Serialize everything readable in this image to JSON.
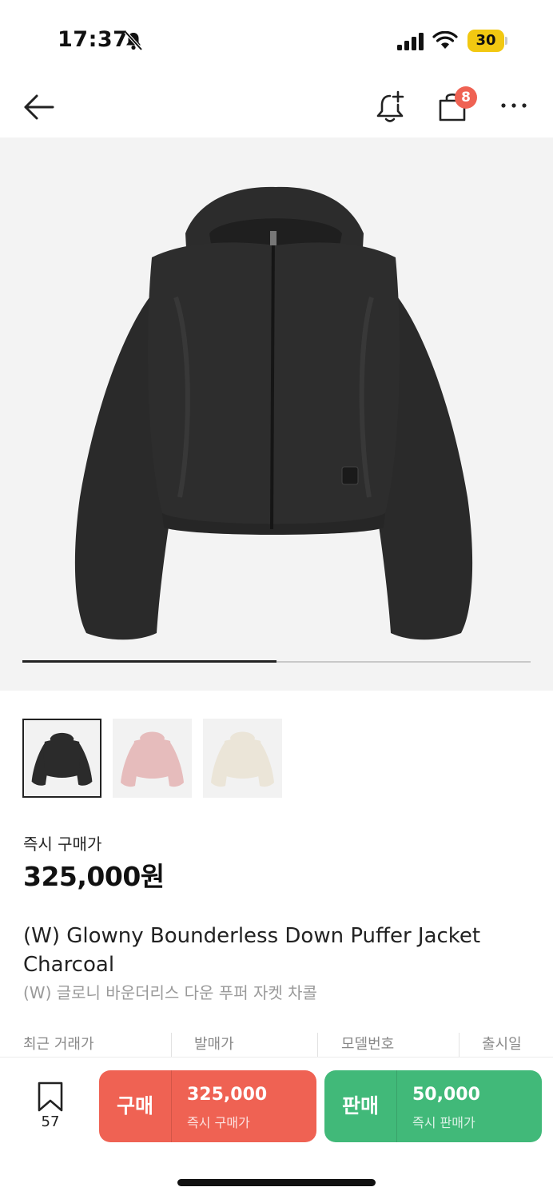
{
  "status_bar": {
    "time": "17:37",
    "battery": "30",
    "icons": [
      "bell-off-icon",
      "signal-icon",
      "wifi-icon",
      "battery-icon"
    ]
  },
  "nav": {
    "icons": [
      "back-arrow-icon",
      "bell-plus-icon",
      "shopping-bag-icon",
      "more-icon"
    ],
    "cart_badge": "8"
  },
  "gallery": {
    "progress": 0.5,
    "thumbnails": [
      {
        "name": "charcoal",
        "color": "#2b2b2b",
        "selected": true
      },
      {
        "name": "pink",
        "color": "#e6bcbc",
        "selected": false
      },
      {
        "name": "cream",
        "color": "#ebe5d8",
        "selected": false
      }
    ]
  },
  "price": {
    "label": "즉시 구매가",
    "value": "325,000원"
  },
  "product": {
    "name_en": "(W) Glowny Bounderless Down Puffer Jacket Charcoal",
    "name_ko": "(W) 글로니 바운더리스 다운 푸퍼 자켓 차콜"
  },
  "info": {
    "columns": [
      "최근 거래가",
      "발매가",
      "모델번호",
      "출시일"
    ]
  },
  "bottom": {
    "bookmark_count": "57",
    "buy": {
      "label": "구매",
      "price": "325,000",
      "sub": "즉시 구매가",
      "color": "#ef6253"
    },
    "sell": {
      "label": "판매",
      "price": "50,000",
      "sub": "즉시 판매가",
      "color": "#41b979"
    }
  }
}
